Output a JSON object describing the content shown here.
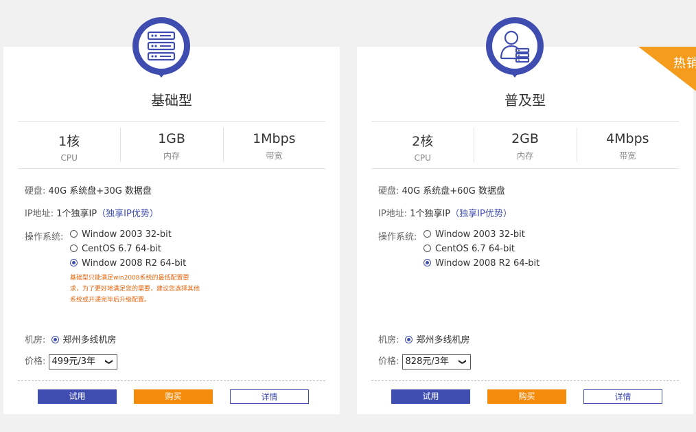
{
  "plans": [
    {
      "name": "基础型",
      "icon": "server-rack-icon",
      "hot": "",
      "specs": [
        {
          "value": "1核",
          "label": "CPU"
        },
        {
          "value": "1GB",
          "label": "内存"
        },
        {
          "value": "1Mbps",
          "label": "带宽"
        }
      ],
      "disk_label": "硬盘:",
      "disk_value": "40G 系统盘+30G 数据盘",
      "ip_label": "IP地址:",
      "ip_value": "1个独享IP",
      "ip_link": "（独享IP优势）",
      "os_label": "操作系统:",
      "os_options": [
        {
          "label": "Window 2003 32-bit",
          "selected": false
        },
        {
          "label": "CentOS 6.7 64-bit",
          "selected": false
        },
        {
          "label": "Window 2008 R2 64-bit",
          "selected": true
        }
      ],
      "os_note": "基础型只能满足win2008系统的最低配置要求，为了更好地满足您的需要，建议您选择其他系统或开通完毕后升级配置。",
      "room_label": "机房:",
      "room_value": "郑州多线机房",
      "price_label": "价格:",
      "price_value": "499元/3年",
      "buttons": {
        "trial": "试用",
        "buy": "购买",
        "detail": "详情"
      }
    },
    {
      "name": "普及型",
      "icon": "user-server-icon",
      "hot": "热销",
      "specs": [
        {
          "value": "2核",
          "label": "CPU"
        },
        {
          "value": "2GB",
          "label": "内存"
        },
        {
          "value": "4Mbps",
          "label": "带宽"
        }
      ],
      "disk_label": "硬盘:",
      "disk_value": "40G 系统盘+60G 数据盘",
      "ip_label": "IP地址:",
      "ip_value": "1个独享IP",
      "ip_link": "（独享IP优势）",
      "os_label": "操作系统:",
      "os_options": [
        {
          "label": "Window 2003 32-bit",
          "selected": false
        },
        {
          "label": "CentOS 6.7 64-bit",
          "selected": false
        },
        {
          "label": "Window 2008 R2 64-bit",
          "selected": true
        }
      ],
      "os_note": "",
      "room_label": "机房:",
      "room_value": "郑州多线机房",
      "price_label": "价格:",
      "price_value": "828元/3年",
      "buttons": {
        "trial": "试用",
        "buy": "购买",
        "detail": "详情"
      }
    }
  ],
  "colors": {
    "primary": "#3f4db1",
    "accent": "#f58b0a",
    "hot": "#f59b1e",
    "note": "#e8650c"
  }
}
